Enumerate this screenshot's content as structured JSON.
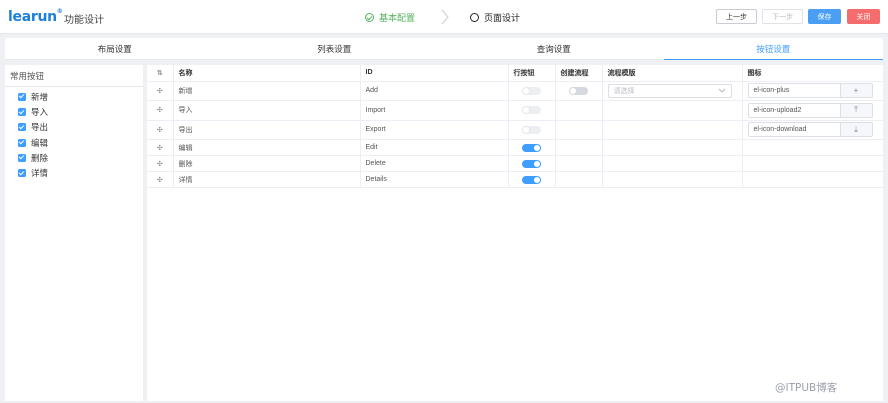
{
  "header": {
    "logo": "learun",
    "logo_mark": "®",
    "title": "功能设计",
    "steps": [
      {
        "label": "基本配置",
        "state": "done"
      },
      {
        "label": "页面设计",
        "state": "current"
      }
    ],
    "buttons": {
      "prev": "上一步",
      "next": "下一步",
      "save": "保存",
      "close": "关闭"
    }
  },
  "tabs": [
    {
      "label": "布局设置",
      "active": false
    },
    {
      "label": "列表设置",
      "active": false
    },
    {
      "label": "查询设置",
      "active": false
    },
    {
      "label": "按钮设置",
      "active": true
    }
  ],
  "sidebar": {
    "title": "常用按钮",
    "items": [
      {
        "label": "新增",
        "checked": true
      },
      {
        "label": "导入",
        "checked": true
      },
      {
        "label": "导出",
        "checked": true
      },
      {
        "label": "编辑",
        "checked": true
      },
      {
        "label": "删除",
        "checked": true
      },
      {
        "label": "详情",
        "checked": true
      }
    ]
  },
  "table": {
    "sort_icon": "⇅",
    "drag_icon": "✣",
    "columns": {
      "name": "名称",
      "id": "ID",
      "row_button": "行按钮",
      "create_flow": "创建流程",
      "flow_template": "流程模版",
      "icon": "图标"
    },
    "select_placeholder": "请选择",
    "rows": [
      {
        "name": "新增",
        "id": "Add",
        "row_button": false,
        "create_flow": false,
        "has_template": true,
        "icon": "el-icon-plus",
        "icon_glyph": "+"
      },
      {
        "name": "导入",
        "id": "Import",
        "row_button": false,
        "create_flow": null,
        "has_template": false,
        "icon": "el-icon-upload2",
        "icon_glyph": "⤒"
      },
      {
        "name": "导出",
        "id": "Export",
        "row_button": false,
        "create_flow": null,
        "has_template": false,
        "icon": "el-icon-download",
        "icon_glyph": "⤓"
      },
      {
        "name": "编辑",
        "id": "Edit",
        "row_button": true,
        "create_flow": null,
        "has_template": false,
        "icon": "",
        "icon_glyph": ""
      },
      {
        "name": "删除",
        "id": "Delete",
        "row_button": true,
        "create_flow": null,
        "has_template": false,
        "icon": "",
        "icon_glyph": ""
      },
      {
        "name": "详情",
        "id": "Details",
        "row_button": true,
        "create_flow": null,
        "has_template": false,
        "icon": "",
        "icon_glyph": ""
      }
    ]
  },
  "watermark": "@ITPUB博客",
  "colors": {
    "primary": "#409eff",
    "success": "#52b35e",
    "danger": "#f56c6c",
    "logo": "#1e7fd6"
  }
}
